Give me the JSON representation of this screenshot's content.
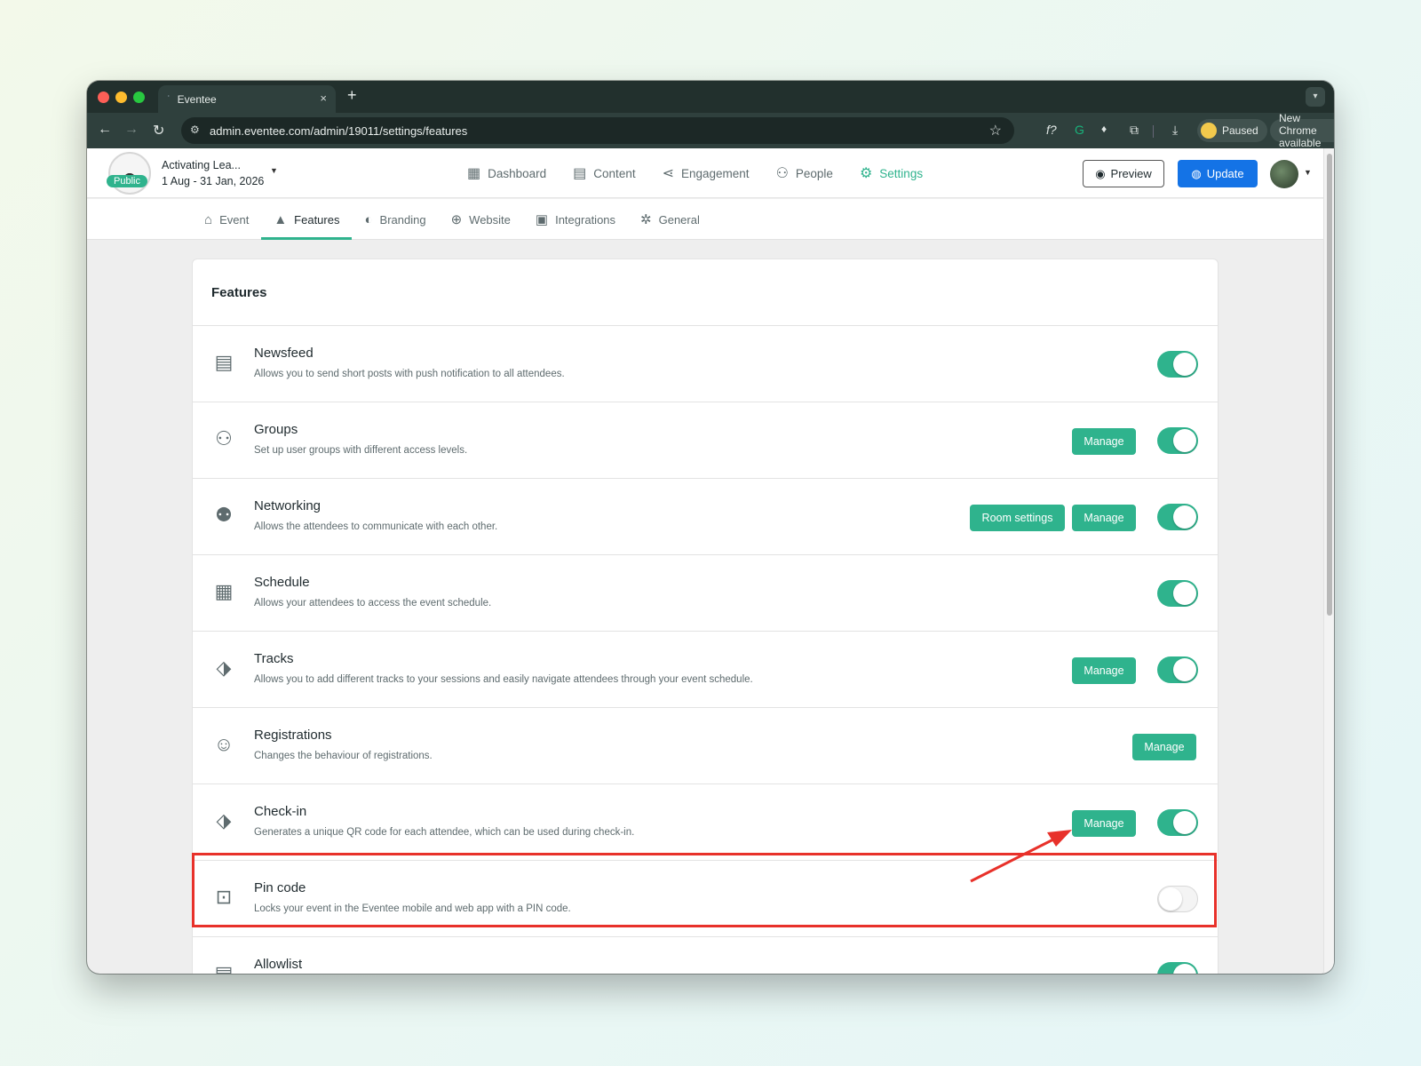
{
  "browser": {
    "tab_title": "Eventee",
    "tab_close": "×",
    "new_tab": "+",
    "url": "admin.eventee.com/admin/19011/settings/features",
    "profile_status": "Paused",
    "update_notice": "New Chrome available"
  },
  "event": {
    "badge": "Public",
    "name": "Activating Lea...",
    "dates": "1 Aug - 31 Jan, 2026"
  },
  "main_nav": [
    {
      "label": "Dashboard",
      "icon": "dashboard-icon"
    },
    {
      "label": "Content",
      "icon": "calendar-icon"
    },
    {
      "label": "Engagement",
      "icon": "share-icon"
    },
    {
      "label": "People",
      "icon": "people-icon"
    },
    {
      "label": "Settings",
      "icon": "gear-icon",
      "active": true
    }
  ],
  "actions": {
    "preview_label": "Preview",
    "update_label": "Update"
  },
  "sub_nav": [
    {
      "label": "Event",
      "icon": "home-icon"
    },
    {
      "label": "Features",
      "icon": "rocket-icon",
      "active": true
    },
    {
      "label": "Branding",
      "icon": "palette-icon"
    },
    {
      "label": "Website",
      "icon": "globe-icon"
    },
    {
      "label": "Integrations",
      "icon": "puzzle-icon"
    },
    {
      "label": "General",
      "icon": "gears-icon"
    }
  ],
  "features": {
    "title": "Features",
    "items": [
      {
        "name": "Newsfeed",
        "description": "Allows you to send short posts with push notification to all attendees.",
        "icon": "newspaper-icon",
        "enabled": true
      },
      {
        "name": "Groups",
        "description": "Set up user groups with different access levels.",
        "icon": "group-icon",
        "manage": "Manage",
        "enabled": true
      },
      {
        "name": "Networking",
        "description": "Allows the attendees to communicate with each other.",
        "icon": "networking-icon",
        "room_settings": "Room settings",
        "manage": "Manage",
        "enabled": true
      },
      {
        "name": "Schedule",
        "description": "Allows your attendees to access the event schedule.",
        "icon": "schedule-icon",
        "enabled": true
      },
      {
        "name": "Tracks",
        "description": "Allows you to add different tracks to your sessions and easily navigate attendees through your event schedule.",
        "icon": "tag-icon",
        "manage": "Manage",
        "enabled": true
      },
      {
        "name": "Registrations",
        "description": "Changes the behaviour of registrations.",
        "icon": "user-check-icon",
        "manage": "Manage"
      },
      {
        "name": "Check-in",
        "description": "Generates a unique QR code for each attendee, which can be used during check-in.",
        "icon": "checkin-tag-icon",
        "manage": "Manage",
        "enabled": true
      },
      {
        "name": "Pin code",
        "description": "Locks your event in the Eventee mobile and web app with a PIN code.",
        "icon": "pin-code-icon",
        "enabled": false
      },
      {
        "name": "Allowlist",
        "description": "",
        "icon": "allowlist-icon",
        "enabled": true
      }
    ]
  },
  "annotation_color": "#e8312a",
  "accent_color": "#2fb38d"
}
